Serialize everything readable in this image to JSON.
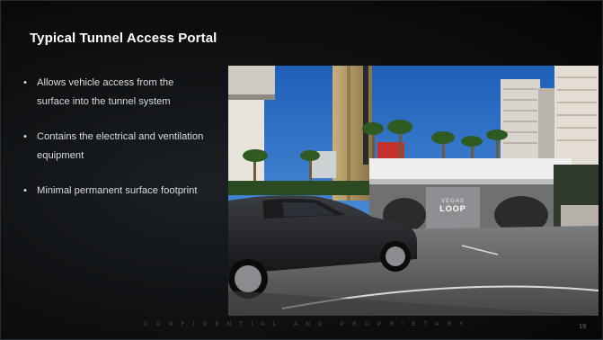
{
  "slide": {
    "title": "Typical Tunnel Access Portal",
    "bullets": [
      "Allows vehicle access from the surface into the tunnel system",
      "Contains the electrical and ventilation equipment",
      "Minimal permanent surface footprint"
    ],
    "bullet_marker": "•",
    "footer": "CONFIDENTIAL AND PROPRIETARY",
    "page_number": "19"
  },
  "photo": {
    "sign_line1": "VEGAS",
    "sign_line2": "LOOP"
  },
  "colors": {
    "background": "#0d0f11",
    "title": "#ffffff",
    "body_text": "#d9dbdd",
    "sky": "#2f6fc4",
    "footer_text": "#4c5054"
  }
}
